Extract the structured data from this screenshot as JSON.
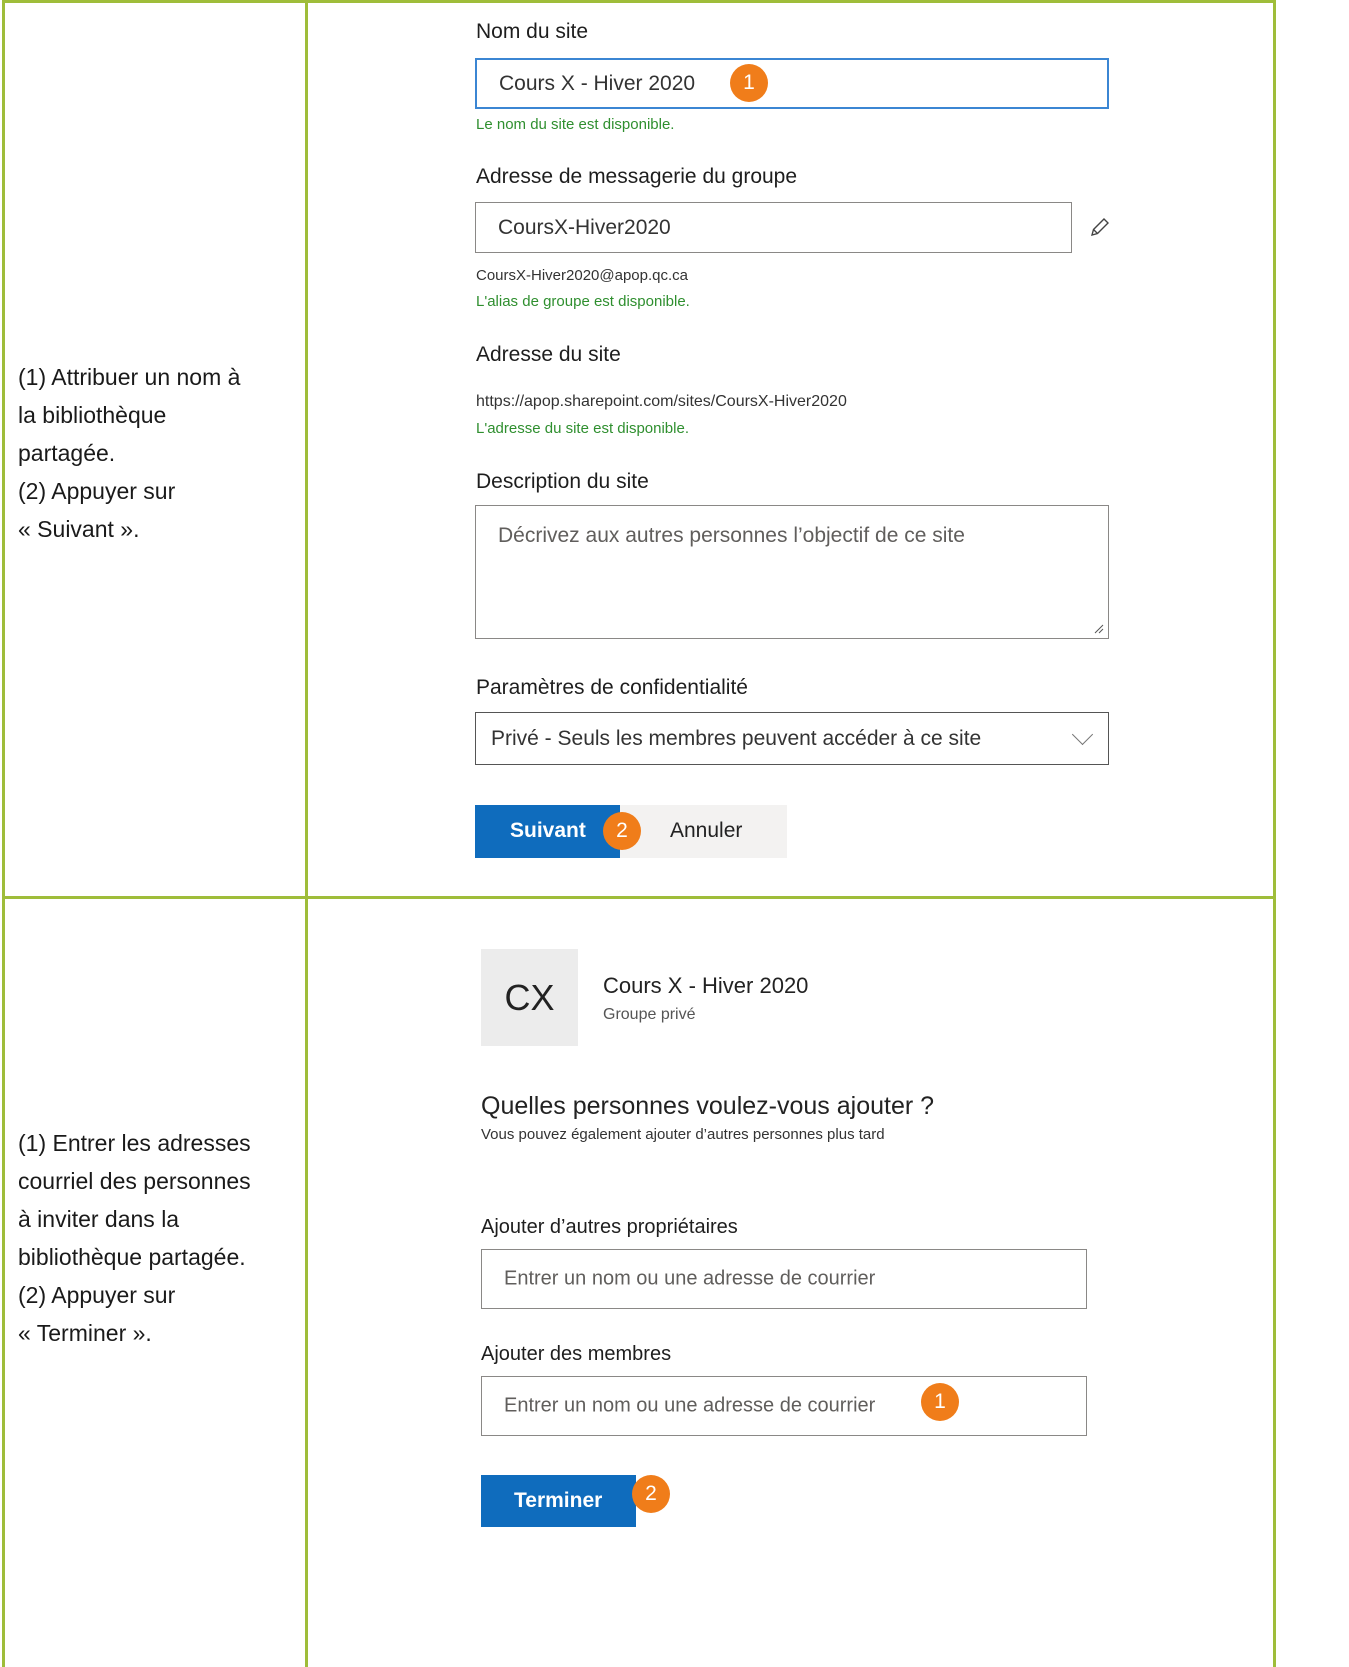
{
  "row1": {
    "instructions": "(1) Attribuer un nom à\nla bibliothèque\npartagée.\n(2) Appuyer sur\n« Suivant ».",
    "site_name_label": "Nom du site",
    "site_name_value": "Cours X - Hiver 2020",
    "site_name_status": "Le nom du site est disponible.",
    "group_email_label": "Adresse de messagerie du groupe",
    "group_email_value": "CoursX-Hiver2020",
    "group_email_full": "CoursX-Hiver2020@apop.qc.ca",
    "group_alias_status": "L'alias de groupe est disponible.",
    "site_address_label": "Adresse du site",
    "site_address_value": "https://apop.sharepoint.com/sites/CoursX-Hiver2020",
    "site_address_status": "L'adresse du site est disponible.",
    "description_label": "Description du site",
    "description_placeholder": "Décrivez aux autres personnes l’objectif de ce site",
    "privacy_label": "Paramètres de confidentialité",
    "privacy_value": "Privé - Seuls les membres peuvent accéder à ce site",
    "next_button": "Suivant",
    "cancel_button": "Annuler",
    "badge_1": "1",
    "badge_2": "2"
  },
  "row2": {
    "instructions": "(1) Entrer les adresses\ncourriel des personnes\nà inviter dans la\nbibliothèque partagée.\n(2) Appuyer sur\n« Terminer ».",
    "avatar_initials": "CX",
    "group_name": "Cours X - Hiver 2020",
    "group_type": "Groupe privé",
    "question": "Quelles personnes voulez-vous ajouter ?",
    "question_sub": "Vous pouvez également ajouter d’autres personnes plus tard",
    "owners_label": "Ajouter d’autres propriétaires",
    "owners_placeholder": "Entrer un nom ou une adresse de courrier",
    "members_label": "Ajouter des membres",
    "members_placeholder": "Entrer un nom ou une adresse de courrier",
    "finish_button": "Terminer",
    "badge_1": "1",
    "badge_2": "2"
  },
  "colors": {
    "border": "#9fbd3a",
    "primary": "#0f6cbd",
    "badge": "#f07d1a",
    "success": "#2f8f2f"
  }
}
